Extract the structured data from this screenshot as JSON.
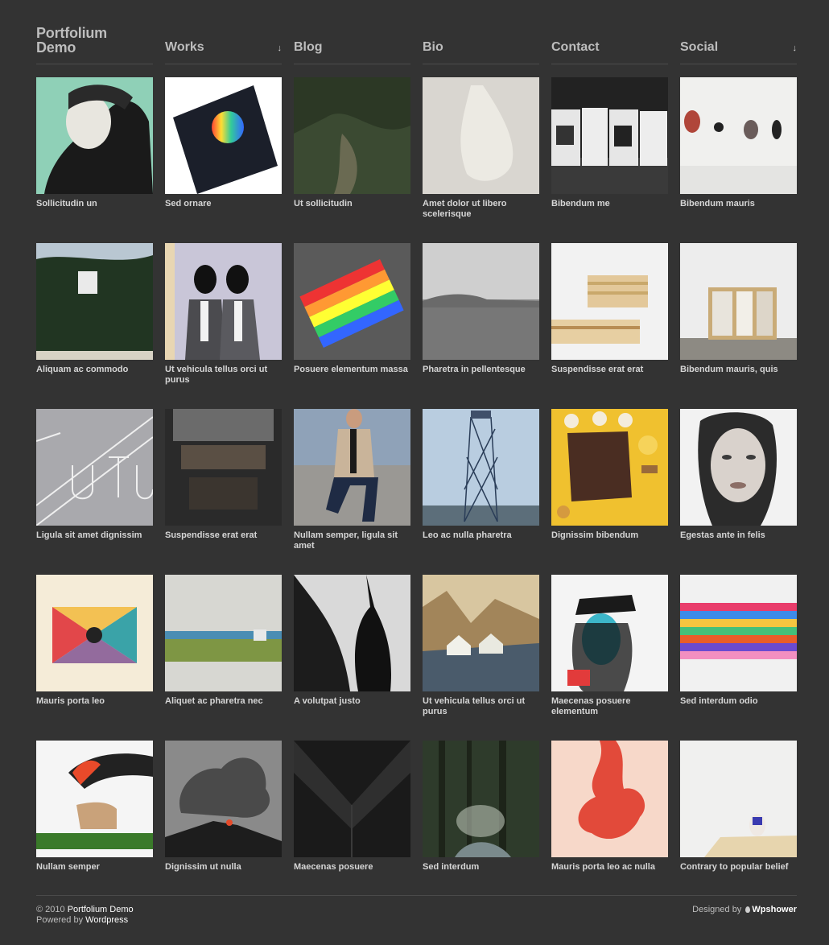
{
  "header": {
    "site_title_line1": "Portfolium",
    "site_title_line2": "Demo",
    "nav": [
      {
        "label": "Works",
        "has_dropdown": true
      },
      {
        "label": "Blog",
        "has_dropdown": false
      },
      {
        "label": "Bio",
        "has_dropdown": false
      },
      {
        "label": "Contact",
        "has_dropdown": false
      },
      {
        "label": "Social",
        "has_dropdown": true
      }
    ],
    "dropdown_glyph": "↓"
  },
  "items": [
    {
      "caption": "Sollicitudin un",
      "thumb": "portrait-teal"
    },
    {
      "caption": "Sed ornare",
      "thumb": "black-book-color-circle"
    },
    {
      "caption": "Ut sollicitudin",
      "thumb": "forest-hill"
    },
    {
      "caption": "Amet dolor ut libero scelerisque",
      "thumb": "white-bag"
    },
    {
      "caption": "Bibendum me",
      "thumb": "book-covers"
    },
    {
      "caption": "Bibendum mauris",
      "thumb": "gallery-wall"
    },
    {
      "caption": "Aliquam ac commodo",
      "thumb": "house-forest"
    },
    {
      "caption": "Ut vehicula tellus orci ut purus",
      "thumb": "suited-figures"
    },
    {
      "caption": "Posuere elementum massa",
      "thumb": "rainbow-pad"
    },
    {
      "caption": "Pharetra in pellentesque",
      "thumb": "misty-coast"
    },
    {
      "caption": "Suspendisse erat erat",
      "thumb": "wood-pallets"
    },
    {
      "caption": "Bibendum mauris, quis",
      "thumb": "bookshelf"
    },
    {
      "caption": "Ligula sit amet dignissim",
      "thumb": "futu-type"
    },
    {
      "caption": "Suspendisse erat erat",
      "thumb": "concrete-stairs"
    },
    {
      "caption": "Nullam semper, ligula sit amet",
      "thumb": "man-sitting"
    },
    {
      "caption": "Leo ac nulla pharetra",
      "thumb": "lattice-tower"
    },
    {
      "caption": "Dignissim bibendum",
      "thumb": "chocolate-yellow"
    },
    {
      "caption": "Egestas ante in felis",
      "thumb": "woman-face"
    },
    {
      "caption": "Mauris porta leo",
      "thumb": "color-x"
    },
    {
      "caption": "Aliquet ac pharetra nec",
      "thumb": "zipper"
    },
    {
      "caption": "A volutpat justo",
      "thumb": "hand-shadow"
    },
    {
      "caption": "Ut vehicula tellus orci ut purus",
      "thumb": "valley-houses"
    },
    {
      "caption": "Maecenas posuere elementum",
      "thumb": "illustration-woman"
    },
    {
      "caption": "Sed interdum odio",
      "thumb": "pixel-stripes"
    },
    {
      "caption": "Nullam semper",
      "thumb": "deer-smoke"
    },
    {
      "caption": "Dignissim ut nulla",
      "thumb": "volcano-smoke"
    },
    {
      "caption": "Maecenas posuere",
      "thumb": "dark-collar"
    },
    {
      "caption": "Sed interdum",
      "thumb": "forest-stream"
    },
    {
      "caption": "Mauris porta leo ac nulla",
      "thumb": "red-ink"
    },
    {
      "caption": "Contrary to popular belief",
      "thumb": "small-figure-table"
    }
  ],
  "footer": {
    "copyright_prefix": "© 2010",
    "site_name": "Portfolium Demo",
    "powered_prefix": "Powered by",
    "powered_name": "Wordpress",
    "designed_prefix": "Designed by",
    "designer_name": "Wpshower"
  }
}
